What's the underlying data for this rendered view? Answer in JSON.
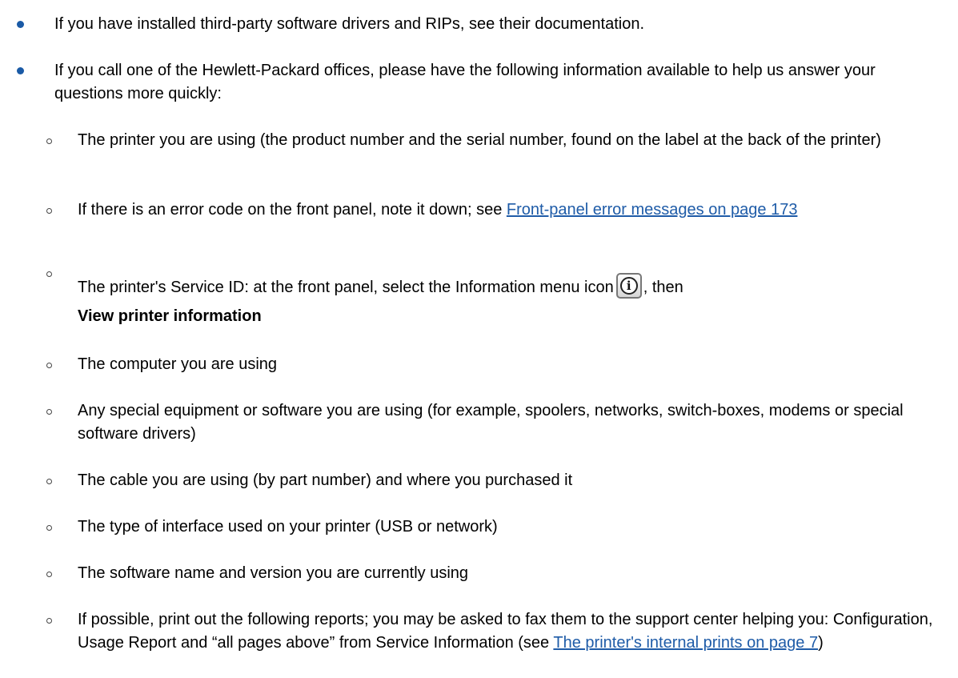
{
  "colors": {
    "bullet": "#1a5aa6",
    "link": "#1f5ca8",
    "text": "#000000"
  },
  "list": {
    "bullet1": "If you have installed third-party software drivers and RIPs, see their documentation.",
    "bullet2": "If you call one of the Hewlett-Packard offices, please have the following information available to help us answer your questions more quickly:",
    "sub1": "The printer you are using (the product number and the serial number, found on the label at the back of the printer)",
    "sub2_text": "If there is an error code on the front panel, note it down; see",
    "sub2_link": "Front-panel error messages on page 173",
    "sub3_text": "The printer's Service ID: at the front panel, select the Information menu icon",
    "sub3_icon": "information-icon",
    "sub3_icon_glyph": "i",
    "sub3_after": ", then",
    "sub3_bold": "View printer information",
    "sub4": "The computer you are using",
    "sub5": "Any special equipment or software you are using (for example, spoolers, networks, switch-boxes, modems or special software drivers)",
    "sub6": "The cable you are using (by part number) and where you purchased it",
    "sub7": "The type of interface used on your printer (USB or network)",
    "sub8": "The software name and version you are currently using",
    "sub9_text": "If possible, print out the following reports; you may be asked to fax them to the support center helping you: Configuration, Usage Report and “all pages above” from Service Information (see",
    "sub9_link": "The printer's internal prints on page 7",
    "sub9_end": ")"
  }
}
